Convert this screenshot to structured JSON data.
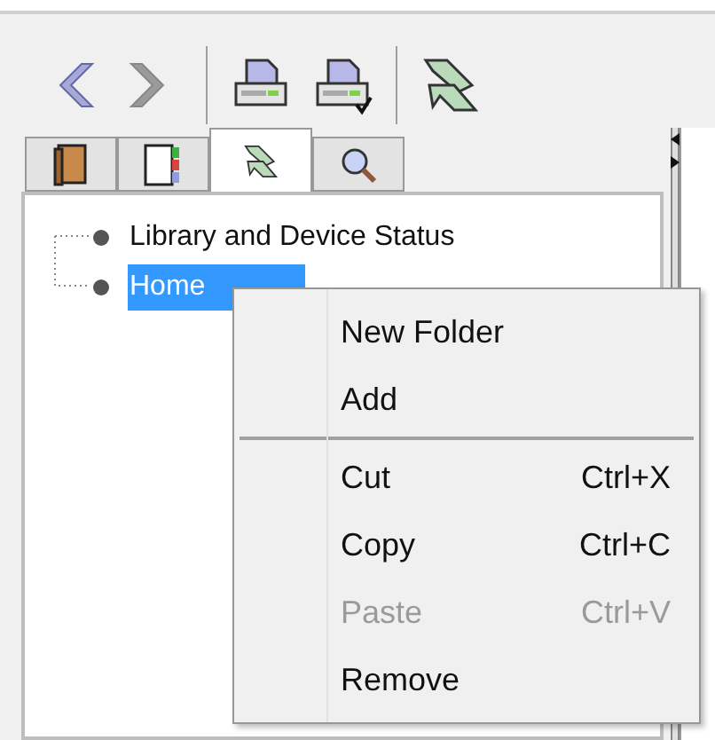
{
  "toolbar": {
    "buttons": [
      {
        "kind": "back",
        "disabled": false
      },
      {
        "kind": "forward",
        "disabled": true
      },
      {
        "kind": "separator"
      },
      {
        "kind": "printer",
        "disabled": false
      },
      {
        "kind": "printer-check",
        "disabled": false
      },
      {
        "kind": "separator"
      },
      {
        "kind": "ribbon",
        "disabled": false
      }
    ]
  },
  "tabs": [
    {
      "kind": "book",
      "selected": false
    },
    {
      "kind": "notebook",
      "selected": false
    },
    {
      "kind": "ribbon",
      "selected": true
    },
    {
      "kind": "search",
      "selected": false
    }
  ],
  "tree": {
    "items": [
      {
        "label": "Library and Device Status",
        "selected": false
      },
      {
        "label": "Home",
        "selected": true
      }
    ]
  },
  "context_menu": {
    "items": [
      {
        "kind": "item",
        "label": "New Folder",
        "disabled": false
      },
      {
        "kind": "item",
        "label": "Add",
        "disabled": false
      },
      {
        "kind": "separator"
      },
      {
        "kind": "item",
        "label": "Cut",
        "shortcut": "Ctrl+X",
        "disabled": false
      },
      {
        "kind": "item",
        "label": "Copy",
        "shortcut": "Ctrl+C",
        "disabled": false
      },
      {
        "kind": "item",
        "label": "Paste",
        "shortcut": "Ctrl+V",
        "disabled": true
      },
      {
        "kind": "item",
        "label": "Remove",
        "disabled": false
      }
    ]
  }
}
